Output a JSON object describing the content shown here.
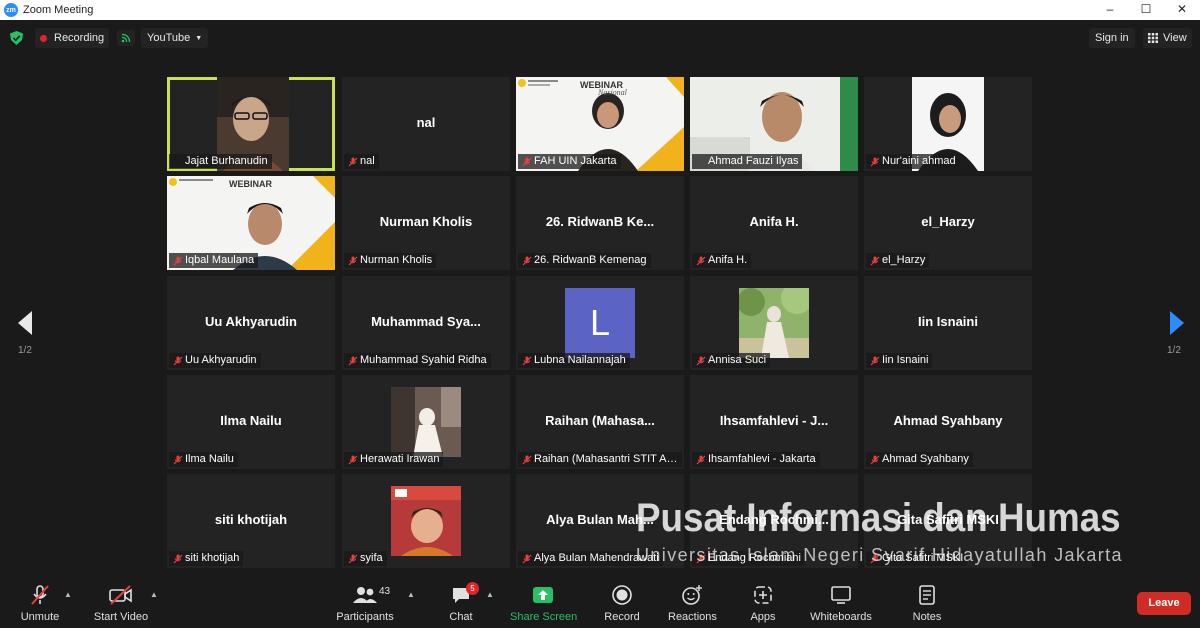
{
  "window": {
    "title": "Zoom Meeting",
    "controls": [
      "–",
      "☐",
      "✕"
    ]
  },
  "topbar": {
    "recording_label": "Recording",
    "stream_label": "YouTube",
    "signin_label": "Sign in",
    "view_label": "View"
  },
  "gallery": {
    "page_left": "1/2",
    "page_right": "1/2",
    "tiles": [
      {
        "big": "",
        "label": "Jajat Burhanudin"
      },
      {
        "big": "nal",
        "label": "nal"
      },
      {
        "big": "",
        "label": "FAH UIN Jakarta"
      },
      {
        "big": "",
        "label": "Ahmad Fauzi Ilyas"
      },
      {
        "big": "",
        "label": "Nur'aini ahmad"
      },
      {
        "big": "",
        "label": "Iqbal Maulana"
      },
      {
        "big": "Nurman Kholis",
        "label": "Nurman Kholis"
      },
      {
        "big": "26. RidwanB Ke...",
        "label": "26. RidwanB Kemenag"
      },
      {
        "big": "Anifa H.",
        "label": "Anifa H."
      },
      {
        "big": "el_Harzy",
        "label": "el_Harzy"
      },
      {
        "big": "Uu Akhyarudin",
        "label": "Uu Akhyarudin"
      },
      {
        "big": "Muhammad Sya...",
        "label": "Muhammad Syahid Ridha"
      },
      {
        "big": "",
        "label": "Lubna Nailannajah",
        "avatar_letter": "L"
      },
      {
        "big": "",
        "label": "Annisa Suci"
      },
      {
        "big": "Iin Isnaini",
        "label": "Iin Isnaini"
      },
      {
        "big": "Ilma Nailu",
        "label": "Ilma Nailu"
      },
      {
        "big": "",
        "label": "Herawati Irawan"
      },
      {
        "big": "Raihan (Mahasa...",
        "label": "Raihan (Mahasantri STIT Ar..."
      },
      {
        "big": "Ihsamfahlevi - J...",
        "label": "Ihsamfahlevi - Jakarta"
      },
      {
        "big": "Ahmad Syahbany",
        "label": "Ahmad Syahbany"
      },
      {
        "big": "siti khotijah",
        "label": "siti khotijah"
      },
      {
        "big": "",
        "label": "syifa"
      },
      {
        "big": "Alya Bulan Mah...",
        "label": "Alya Bulan Mahendrawati"
      },
      {
        "big": "Endang Rochmi...",
        "label": "Endang Rochmiani"
      },
      {
        "big": "Gita Safitri MSKI",
        "label": "Gita Safitri MSKI"
      }
    ],
    "webinar_text": "WEBINAR",
    "webinar_script": "Nasional"
  },
  "toolbar": {
    "unmute": "Unmute",
    "start_video": "Start Video",
    "participants": "Participants",
    "participants_count": "43",
    "chat": "Chat",
    "chat_badge": "5",
    "share_screen": "Share Screen",
    "record": "Record",
    "reactions": "Reactions",
    "apps": "Apps",
    "whiteboards": "Whiteboards",
    "notes": "Notes",
    "leave": "Leave"
  },
  "watermark": {
    "title": "Pusat Informasi dan Humas",
    "subtitle": "Universitas Islam Negeri Syarif Hidayatullah Jakarta"
  },
  "colors": {
    "accent_green": "#27c065",
    "leave_red": "#d02b25",
    "active_speaker": "#c6e34c",
    "zoom_blue": "#2d8cff"
  }
}
